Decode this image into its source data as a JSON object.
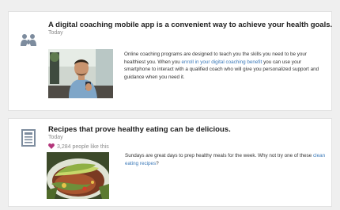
{
  "feed": {
    "items": [
      {
        "icon": "people-group-icon",
        "title": "A digital coaching mobile app is a convenient way to achieve your health goals.",
        "date": "Today",
        "body_before": "Online coaching programs are designed to teach you the skills you need to be your healthiest you. When you ",
        "link": "enroll in your digital coaching benefit",
        "body_after": " you can use your smartphone to interact with a qualified coach who will give you personalized support and guidance when you need it."
      },
      {
        "icon": "newspaper-icon",
        "title": "Recipes that prove healthy eating can be delicious.",
        "date": "Today",
        "likes": "3,284 people like this",
        "body_before": "Sundays are great days to prep healthy  meals for the week. Why not try one of these ",
        "link": "clean eating recipes",
        "body_after": "?"
      }
    ]
  },
  "colors": {
    "link": "#3b79b8",
    "like_heart": "#b3357a",
    "page_bg": "#efefef"
  }
}
